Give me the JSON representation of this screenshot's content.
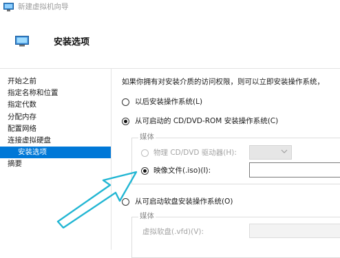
{
  "window": {
    "title": "新建虚拟机向导"
  },
  "header": {
    "title": "安装选项"
  },
  "sidebar": {
    "items": [
      {
        "label": "开始之前"
      },
      {
        "label": "指定名称和位置"
      },
      {
        "label": "指定代数"
      },
      {
        "label": "分配内存"
      },
      {
        "label": "配置网络"
      },
      {
        "label": "连接虚拟硬盘"
      },
      {
        "label": "安装选项",
        "active": true
      },
      {
        "label": "摘要"
      }
    ]
  },
  "main": {
    "description": "如果你拥有对安装介质的访问权限，则可以立即安装操作系统，",
    "options": {
      "later": {
        "label": "以后安装操作系统(L)",
        "checked": false
      },
      "cd_dvd": {
        "label": "从可启动的 CD/DVD-ROM 安装操作系统(C)",
        "checked": true,
        "media_legend": "媒体",
        "physical_drive": {
          "label": "物理 CD/DVD 驱动器(H):",
          "checked": false,
          "enabled": false
        },
        "image_file": {
          "label": "映像文件(.iso)(I):",
          "checked": true,
          "value": ""
        }
      },
      "floppy": {
        "label": "从可启动软盘安装操作系统(O)",
        "checked": false,
        "media_legend": "媒体",
        "vfd_label": "虚拟软盘(.vfd)(V):",
        "vfd_value": ""
      }
    }
  },
  "colors": {
    "accent": "#0078d7",
    "annotation_arrow": "#22b6d3"
  },
  "icons": {
    "app": "monitor-icon",
    "header": "monitor-icon",
    "dropdown": "chevron-down-icon"
  }
}
